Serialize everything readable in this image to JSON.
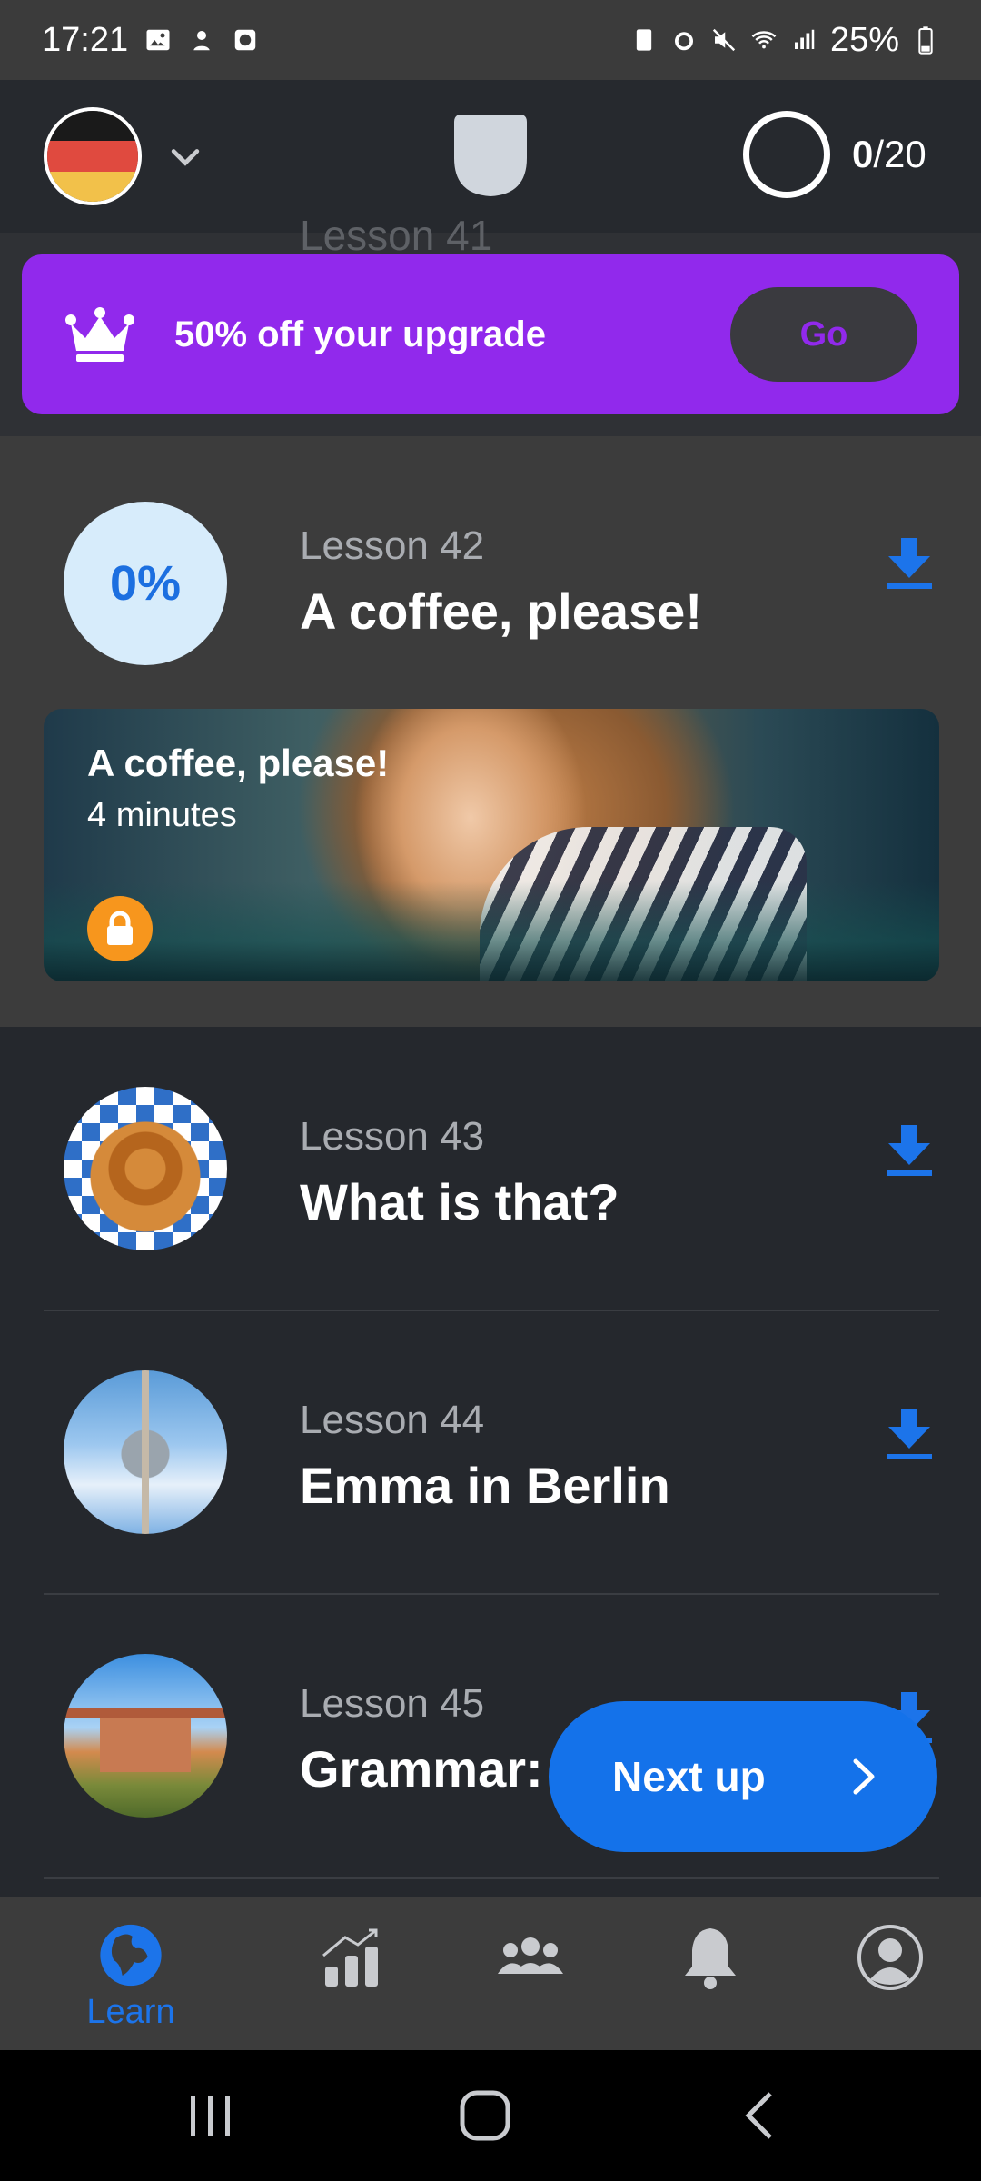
{
  "status_bar": {
    "time": "17:21",
    "battery": "25%"
  },
  "header": {
    "language_flag": "german-flag",
    "goal_done": "0",
    "goal_total": "/20"
  },
  "promo": {
    "text": "50% off your upgrade",
    "button_label": "Go",
    "ghost_lesson": "Lesson 41"
  },
  "current_lesson": {
    "progress": "0%",
    "number": "Lesson 42",
    "title": "A coffee, please!",
    "card_title": "A coffee, please!",
    "card_duration": "4 minutes"
  },
  "lessons": [
    {
      "number": "Lesson 43",
      "title": "What is that?",
      "thumb": "pretzel"
    },
    {
      "number": "Lesson 44",
      "title": "Emma in Berlin",
      "thumb": "tv-tower"
    },
    {
      "number": "Lesson 45",
      "title": "Grammar:",
      "thumb": "castle"
    }
  ],
  "next_up": {
    "label": "Next up"
  },
  "bottom_nav": {
    "learn_label": "Learn"
  },
  "colors": {
    "accent_blue": "#1472ea",
    "promo_purple": "#9129ec",
    "lock_orange": "#f7961d"
  }
}
